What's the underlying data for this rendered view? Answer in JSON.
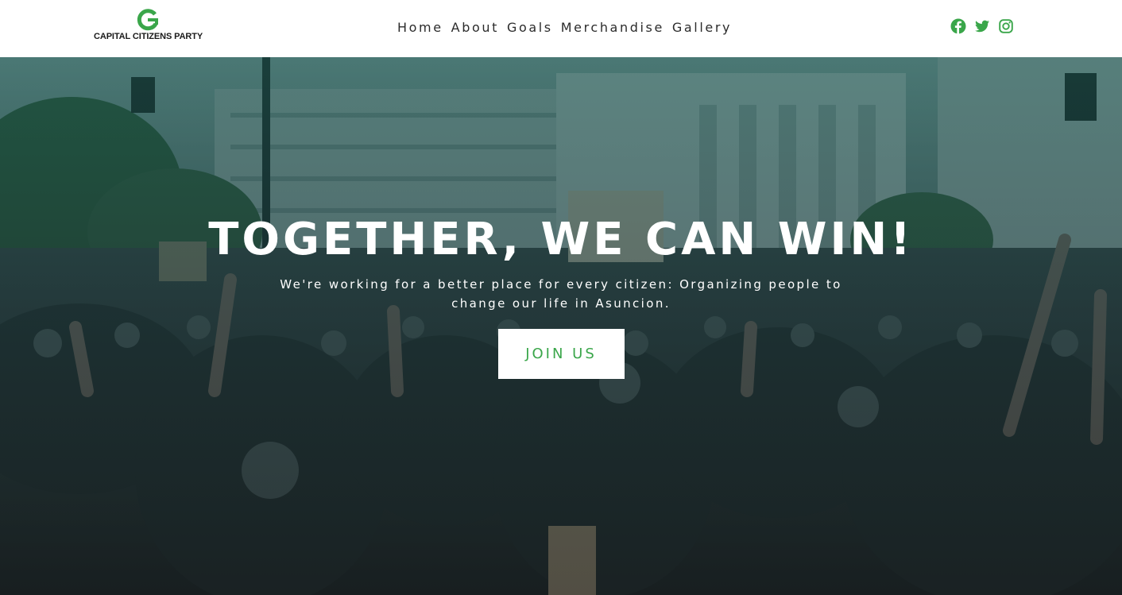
{
  "brand": {
    "name": "CAPITAL CITIZENS PARTY",
    "logo_icon": "green-c-logo-icon",
    "accent_color": "#3aa64a"
  },
  "nav": {
    "items": [
      {
        "label": "Home"
      },
      {
        "label": "About"
      },
      {
        "label": "Goals"
      },
      {
        "label": "Merchandise"
      },
      {
        "label": "Gallery"
      }
    ]
  },
  "social": [
    {
      "icon": "facebook-icon"
    },
    {
      "icon": "twitter-icon"
    },
    {
      "icon": "instagram-icon"
    }
  ],
  "hero": {
    "title": "TOGETHER, WE CAN WIN!",
    "subtitle": "We're working for a better place for every citizen: Organizing people to change our life in Asuncion.",
    "cta_label": "JOIN US",
    "background": "protest-crowd-photo"
  }
}
